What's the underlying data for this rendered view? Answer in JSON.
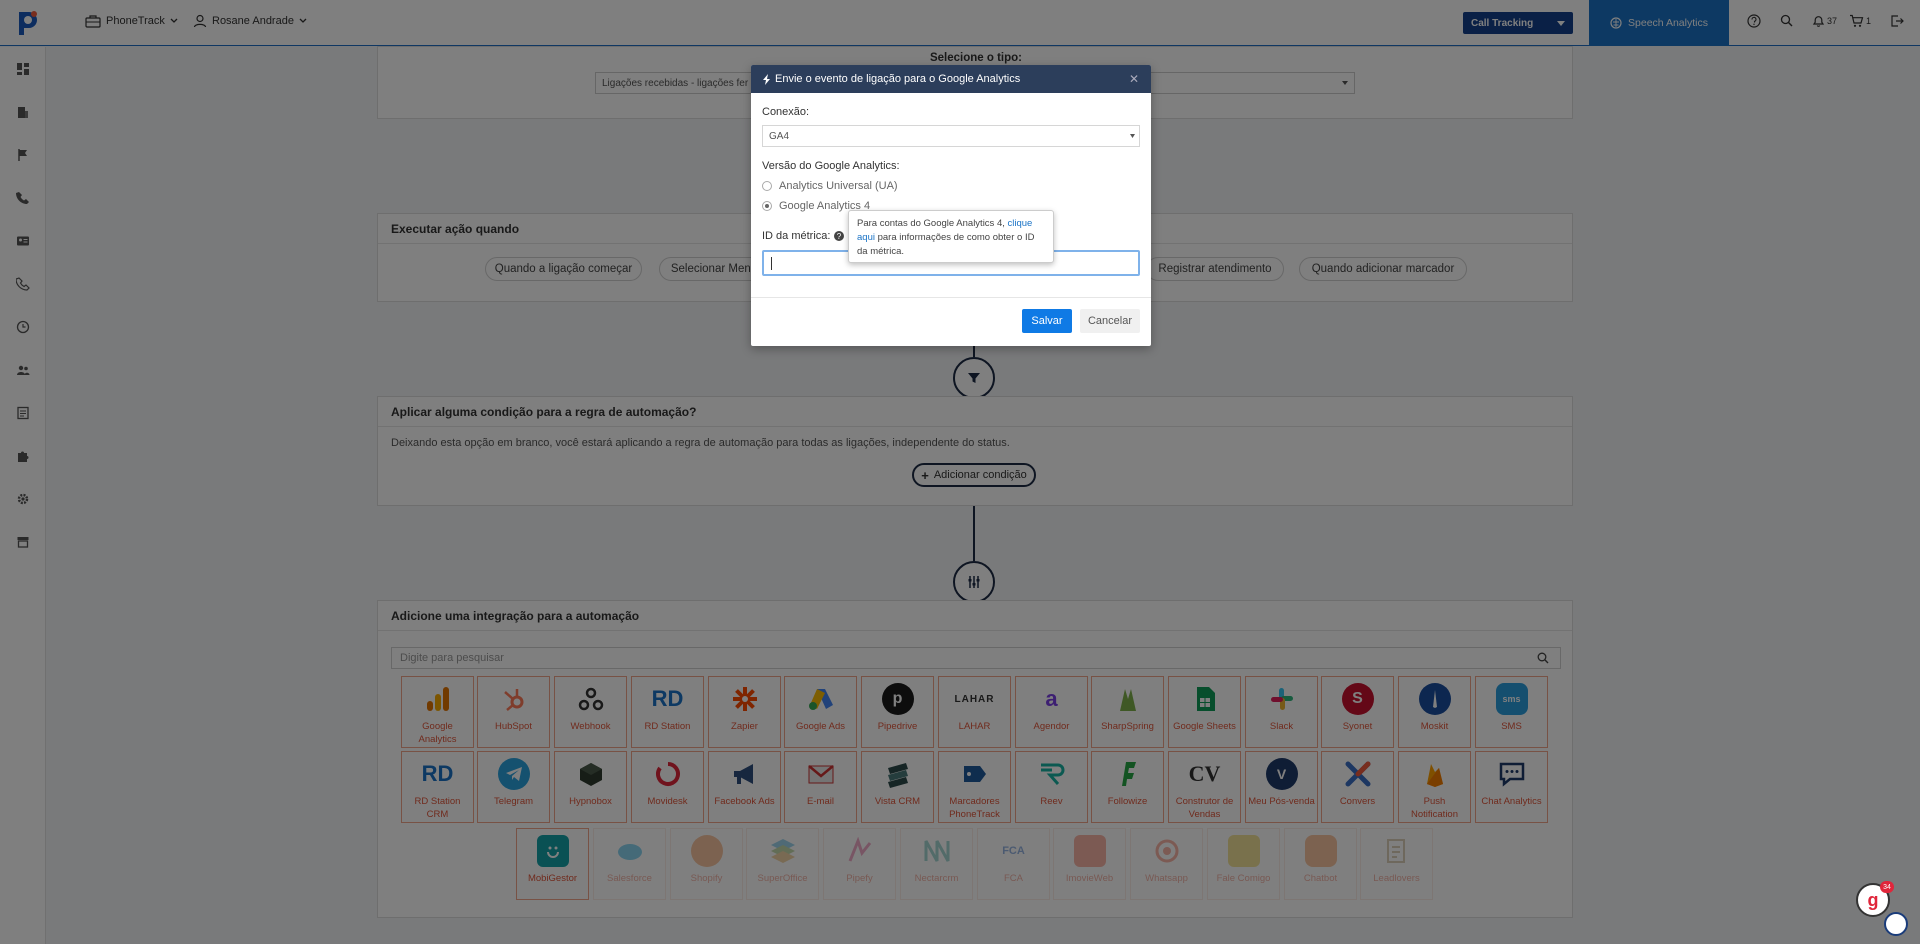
{
  "topbar": {
    "app_menu": "PhoneTrack",
    "user_menu": "Rosane Andrade",
    "call_tracking": "Call Tracking",
    "speech_analytics": "Speech Analytics",
    "notifications_count": "37",
    "cart_count": "1"
  },
  "background": {
    "select_type_label": "Selecione o tipo:",
    "select_type_value": "Ligações recebidas - ligações fer",
    "action_panel_title": "Executar ação quando",
    "action_pills": [
      "Quando a ligação começar",
      "Selecionar Menu",
      "Registrar atendimento",
      "Quando adicionar marcador"
    ],
    "condition_panel_title": "Aplicar alguma condição para a regra de automação?",
    "condition_text": "Deixando esta opção em branco, você estará aplicando a regra de automação para todas as ligações, independente do status.",
    "add_condition": "Adicionar condição",
    "integration_panel_title": "Adicione uma integração para a automação",
    "search_placeholder": "Digite para pesquisar",
    "integrations_row1": [
      "Google Analytics",
      "HubSpot",
      "Webhook",
      "RD Station",
      "Zapier",
      "Google Ads",
      "Pipedrive",
      "LAHAR",
      "Agendor",
      "SharpSpring",
      "Google Sheets",
      "Slack",
      "Syonet",
      "Moskit",
      "SMS"
    ],
    "integrations_row2": [
      "RD Station CRM",
      "Telegram",
      "Hypnobox",
      "Movidesk",
      "Facebook Ads",
      "E-mail",
      "Vista CRM",
      "Marcadores PhoneTrack",
      "Reev",
      "Followize",
      "Construtor de Vendas",
      "Meu Pós-venda",
      "Convers",
      "Push Notification",
      "Chat Analytics"
    ],
    "integrations_row3": [
      "MobiGestor",
      "Salesforce",
      "Shopify",
      "SuperOffice",
      "Pipefy",
      "Nectarcrm",
      "FCA",
      "ImovieWeb",
      "Whatsapp",
      "Fale Comigo",
      "Chatbot",
      "Leadlovers"
    ]
  },
  "modal": {
    "title": "Envie o evento de ligação para o Google Analytics",
    "connection_label": "Conexão:",
    "connection_value": "GA4",
    "version_label": "Versão do Google Analytics:",
    "version_options": [
      "Analytics Universal (UA)",
      "Google Analytics 4"
    ],
    "metric_label": "ID da métrica:",
    "metric_value": "",
    "save": "Salvar",
    "cancel": "Cancelar",
    "tooltip_pre": "Para contas do Google Analytics 4,",
    "tooltip_link": "clique aqui",
    "tooltip_post": "para informações de como obter o ID da métrica."
  },
  "chat_badge": "34",
  "colors": {
    "accent": "#0f7ae5",
    "modal_header": "#2c3e5b",
    "integration_label": "#e0563b",
    "speech_button": "#1a73c6"
  }
}
